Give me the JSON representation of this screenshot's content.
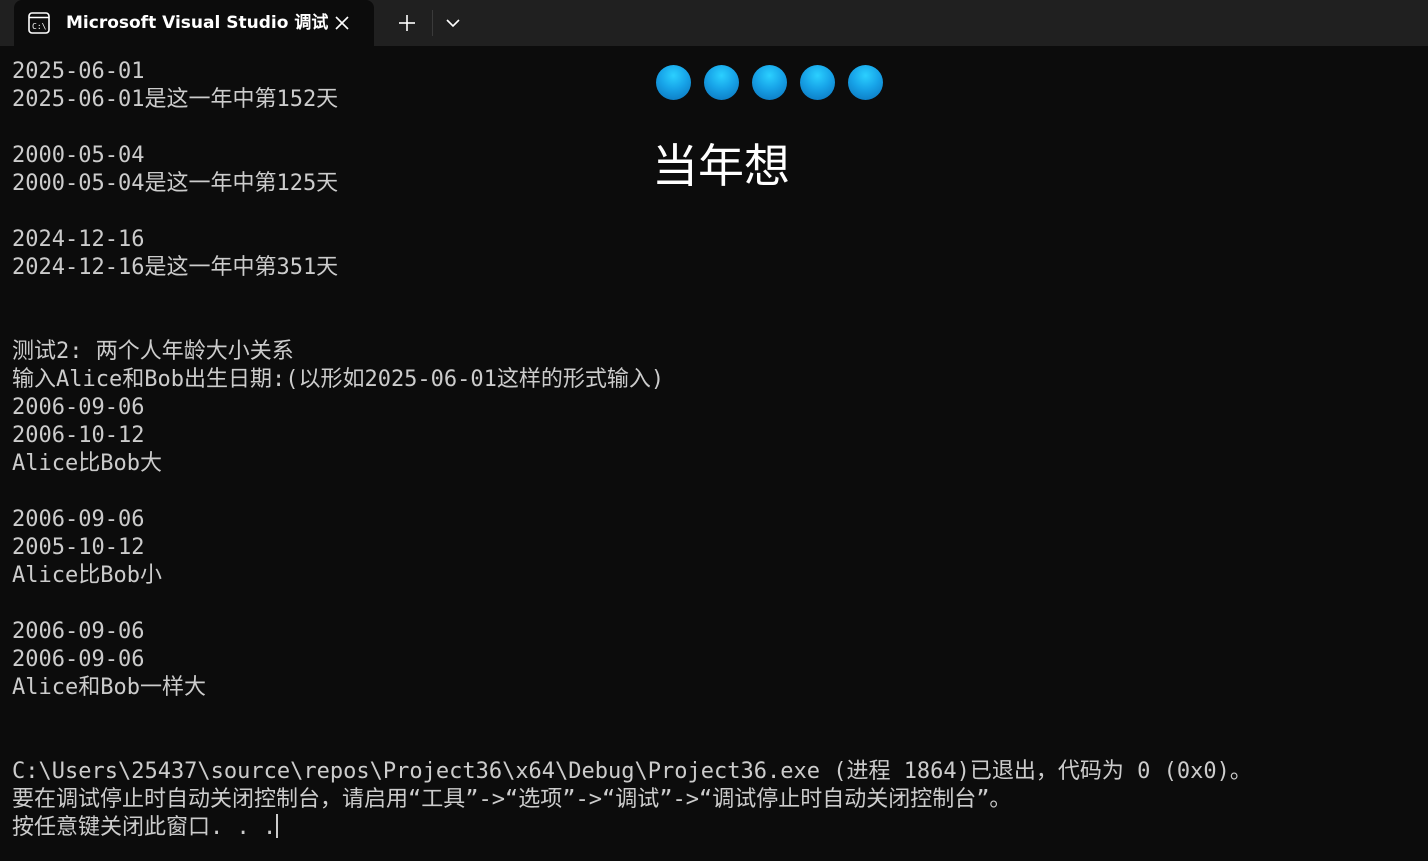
{
  "tab": {
    "title": "Microsoft Visual Studio 调试控制台",
    "icon": "console-icon"
  },
  "tab_controls": {
    "close_icon": "close-icon",
    "new_tab_icon": "plus-icon",
    "dropdown_icon": "chevron-down-icon"
  },
  "overlay": {
    "dot_color": "#1aa6e8",
    "dot_count": 5,
    "text": "当年想"
  },
  "console": {
    "lines": [
      "2025-06-01",
      "2025-06-01是这一年中第152天",
      "",
      "2000-05-04",
      "2000-05-04是这一年中第125天",
      "",
      "2024-12-16",
      "2024-12-16是这一年中第351天",
      "",
      "",
      "测试2: 两个人年龄大小关系",
      "输入Alice和Bob出生日期:(以形如2025-06-01这样的形式输入)",
      "2006-09-06",
      "2006-10-12",
      "Alice比Bob大",
      "",
      "2006-09-06",
      "2005-10-12",
      "Alice比Bob小",
      "",
      "2006-09-06",
      "2006-09-06",
      "Alice和Bob一样大",
      "",
      "",
      "C:\\Users\\25437\\source\\repos\\Project36\\x64\\Debug\\Project36.exe (进程 1864)已退出，代码为 0 (0x0)。",
      "要在调试停止时自动关闭控制台，请启用“工具”->“选项”->“调试”->“调试停止时自动关闭控制台”。",
      "按任意键关闭此窗口. . ."
    ]
  },
  "colors": {
    "background": "#0c0c0c",
    "tabbar": "#202020",
    "text": "#cccccc",
    "accent": "#1aa6e8"
  }
}
